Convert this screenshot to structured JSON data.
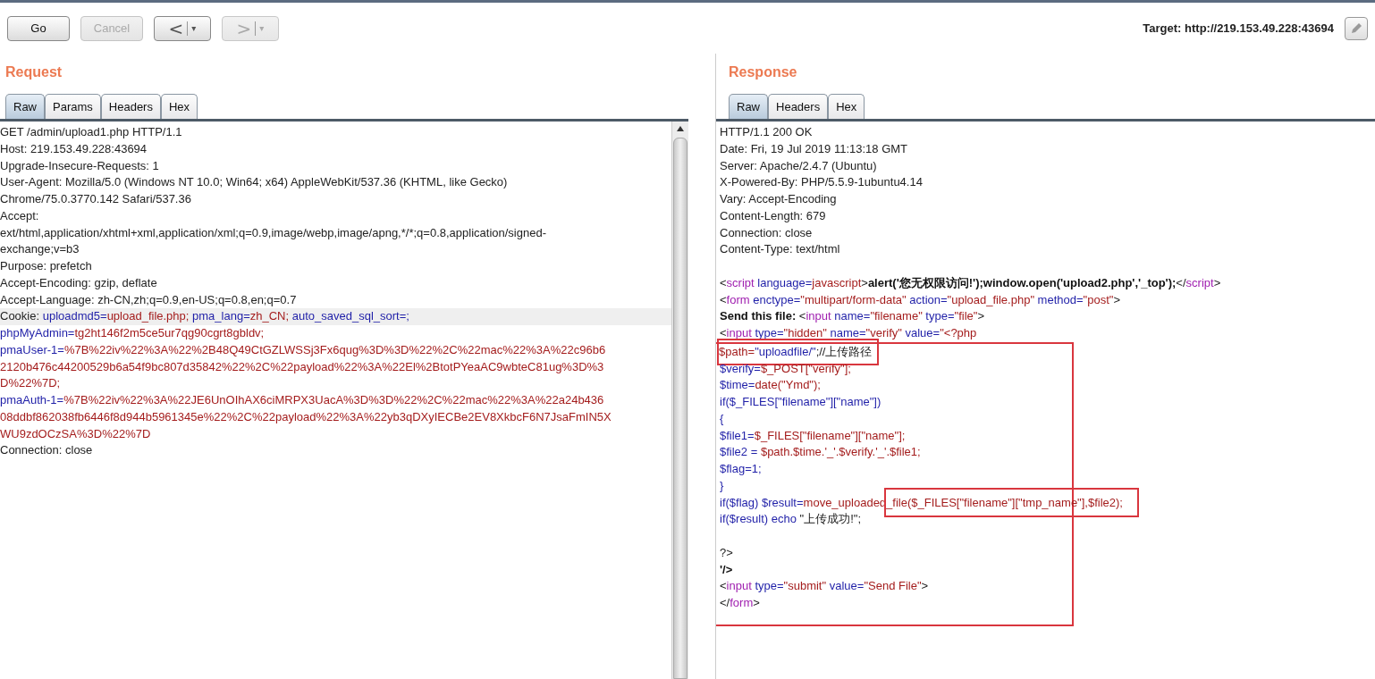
{
  "toolbar": {
    "buttons": [
      {
        "label": "Go",
        "disabled": false
      },
      {
        "label": "Cancel",
        "disabled": true
      }
    ],
    "nav": [
      {
        "arrow": "<",
        "menu": "▾",
        "disabled": false
      },
      {
        "arrow": ">",
        "menu": "▾",
        "disabled": true
      }
    ],
    "target": "Target: http://219.153.49.228:43694"
  },
  "request": {
    "title": "Request",
    "tabs": [
      {
        "label": "Raw",
        "selected": true
      },
      {
        "label": "Params",
        "selected": false
      },
      {
        "label": "Headers",
        "selected": false
      },
      {
        "label": "Hex",
        "selected": false
      }
    ],
    "lines": [
      {
        "highlighted": false,
        "segments": [
          {
            "kind": "plain",
            "text": "GET /admin/upload1.php HTTP/1.1"
          }
        ]
      },
      {
        "highlighted": false,
        "segments": [
          {
            "kind": "plain",
            "text": "Host: 219.153.49.228:43694"
          }
        ]
      },
      {
        "highlighted": false,
        "segments": [
          {
            "kind": "plain",
            "text": "Upgrade-Insecure-Requests: 1"
          }
        ]
      },
      {
        "highlighted": false,
        "segments": [
          {
            "kind": "plain",
            "text": "User-Agent: Mozilla/5.0 (Windows NT 10.0; Win64; x64) AppleWebKit/537.36 (KHTML, like Gecko)"
          }
        ]
      },
      {
        "highlighted": false,
        "segments": [
          {
            "kind": "plain",
            "text": "Chrome/75.0.3770.142 Safari/537.36"
          }
        ]
      },
      {
        "highlighted": false,
        "segments": [
          {
            "kind": "plain",
            "text": "Accept:"
          }
        ]
      },
      {
        "highlighted": false,
        "segments": [
          {
            "kind": "plain",
            "text": "ext/html,application/xhtml+xml,application/xml;q=0.9,image/webp,image/apng,*/*;q=0.8,application/signed-"
          }
        ]
      },
      {
        "highlighted": false,
        "segments": [
          {
            "kind": "plain",
            "text": "exchange;v=b3"
          }
        ]
      },
      {
        "highlighted": false,
        "segments": [
          {
            "kind": "plain",
            "text": "Purpose: prefetch"
          }
        ]
      },
      {
        "highlighted": false,
        "segments": [
          {
            "kind": "plain",
            "text": "Accept-Encoding: gzip, deflate"
          }
        ]
      },
      {
        "highlighted": false,
        "segments": [
          {
            "kind": "plain",
            "text": "Accept-Language: zh-CN,zh;q=0.9,en-US;q=0.8,en;q=0.7"
          }
        ]
      },
      {
        "highlighted": true,
        "segments": [
          {
            "kind": "plain",
            "text": "Cookie: "
          },
          {
            "kind": "key",
            "text": "uploadmd5="
          },
          {
            "kind": "value",
            "text": "upload_file.php;"
          },
          {
            "kind": "key",
            "text": " pma_lang="
          },
          {
            "kind": "value",
            "text": "zh_CN;"
          },
          {
            "kind": "key",
            "text": " auto_saved_sql_sort=;"
          }
        ]
      },
      {
        "highlighted": false,
        "segments": [
          {
            "kind": "key",
            "text": "phpMyAdmin="
          },
          {
            "kind": "value",
            "text": "tg2ht146f2m5ce5ur7qg90cgrt8gbldv;"
          }
        ]
      },
      {
        "highlighted": false,
        "segments": [
          {
            "kind": "key",
            "text": "pmaUser-1="
          },
          {
            "kind": "value",
            "text": "%7B%22iv%22%3A%22%2B48Q49CtGZLWSSj3Fx6qug%3D%3D%22%2C%22mac%22%3A%22c96b6"
          }
        ]
      },
      {
        "highlighted": false,
        "segments": [
          {
            "kind": "value",
            "text": "2120b476c44200529b6a54f9bc807d35842%22%2C%22payload%22%3A%22El%2BtotPYeaAC9wbteC81ug%3D%3"
          }
        ]
      },
      {
        "highlighted": false,
        "segments": [
          {
            "kind": "value",
            "text": "D%22%7D;"
          }
        ]
      },
      {
        "highlighted": false,
        "segments": [
          {
            "kind": "key",
            "text": "pmaAuth-1="
          },
          {
            "kind": "value",
            "text": "%7B%22iv%22%3A%22JE6UnOIhAX6ciMRPX3UacA%3D%3D%22%2C%22mac%22%3A%22a24b436"
          }
        ]
      },
      {
        "highlighted": false,
        "segments": [
          {
            "kind": "value",
            "text": "08ddbf862038fb6446f8d944b5961345e%22%2C%22payload%22%3A%22yb3qDXyIECBe2EV8XkbcF6N7JsaFmIN5X"
          }
        ]
      },
      {
        "highlighted": false,
        "segments": [
          {
            "kind": "value",
            "text": "WU9zdOCzSA%3D%22%7D"
          }
        ]
      },
      {
        "highlighted": false,
        "segments": [
          {
            "kind": "plain",
            "text": "Connection: close"
          }
        ]
      }
    ]
  },
  "response": {
    "title": "Response",
    "tabs": [
      {
        "label": "Raw",
        "selected": true
      },
      {
        "label": "Headers",
        "selected": false
      },
      {
        "label": "Hex",
        "selected": false
      }
    ],
    "blocks": [
      {
        "kind": "plain",
        "lines": [
          {
            "kind": "code",
            "segments": [
              {
                "kind": "plain",
                "text": "HTTP/1.1 200 OK"
              }
            ]
          },
          {
            "kind": "code",
            "segments": [
              {
                "kind": "plain",
                "text": "Date: Fri, 19 Jul 2019 11:13:18 GMT"
              }
            ]
          },
          {
            "kind": "code",
            "segments": [
              {
                "kind": "plain",
                "text": "Server: Apache/2.4.7 (Ubuntu)"
              }
            ]
          },
          {
            "kind": "code",
            "segments": [
              {
                "kind": "plain",
                "text": "X-Powered-By: PHP/5.5.9-1ubuntu4.14"
              }
            ]
          },
          {
            "kind": "code",
            "segments": [
              {
                "kind": "plain",
                "text": "Vary: Accept-Encoding"
              }
            ]
          },
          {
            "kind": "code",
            "segments": [
              {
                "kind": "plain",
                "text": "Content-Length: 679"
              }
            ]
          },
          {
            "kind": "code",
            "segments": [
              {
                "kind": "plain",
                "text": "Connection: close"
              }
            ]
          },
          {
            "kind": "code",
            "segments": [
              {
                "kind": "plain",
                "text": "Content-Type: text/html"
              }
            ]
          },
          {
            "kind": "blank"
          },
          {
            "kind": "code",
            "segments": [
              {
                "kind": "plain",
                "text": "<"
              },
              {
                "kind": "tag",
                "text": "script"
              },
              {
                "kind": "key",
                "text": " language="
              },
              {
                "kind": "value",
                "text": "javascript"
              },
              {
                "kind": "plain",
                "text": ">"
              },
              {
                "kind": "bold",
                "text": "alert('您无权限访问!');window.open('upload2.php','_top');"
              },
              {
                "kind": "plain",
                "text": "</"
              },
              {
                "kind": "tag",
                "text": "script"
              },
              {
                "kind": "plain",
                "text": ">"
              }
            ]
          },
          {
            "kind": "code",
            "segments": [
              {
                "kind": "plain",
                "text": "<"
              },
              {
                "kind": "tag",
                "text": "form"
              },
              {
                "kind": "key",
                "text": " enctype="
              },
              {
                "kind": "value",
                "text": "\"multipart/form-data\""
              },
              {
                "kind": "key",
                "text": " action="
              },
              {
                "kind": "value",
                "text": "\"upload_file.php\""
              },
              {
                "kind": "key",
                "text": " method="
              },
              {
                "kind": "value",
                "text": "\"post\""
              },
              {
                "kind": "plain",
                "text": ">"
              }
            ]
          },
          {
            "kind": "code",
            "segments": [
              {
                "kind": "bold",
                "text": "Send this file: "
              },
              {
                "kind": "plain",
                "text": "<"
              },
              {
                "kind": "tag",
                "text": "input"
              },
              {
                "kind": "key",
                "text": " name="
              },
              {
                "kind": "value",
                "text": "\"filename\""
              },
              {
                "kind": "key",
                "text": " type="
              },
              {
                "kind": "value",
                "text": "\"file\""
              },
              {
                "kind": "plain",
                "text": ">"
              }
            ]
          },
          {
            "kind": "code",
            "segments": [
              {
                "kind": "plain",
                "text": "<"
              },
              {
                "kind": "tag",
                "text": "input"
              },
              {
                "kind": "key",
                "text": " type="
              },
              {
                "kind": "value",
                "text": "\"hidden\""
              },
              {
                "kind": "key",
                "text": " name="
              },
              {
                "kind": "value",
                "text": "\"verify\""
              },
              {
                "kind": "key",
                "text": " value="
              },
              {
                "kind": "value",
                "text": "\"<?php"
              }
            ]
          }
        ]
      },
      {
        "kind": "framed",
        "lines": [
          {
            "kind": "code",
            "boxed_part": [
              {
                "kind": "value",
                "text": "$path="
              },
              {
                "kind": "key",
                "text": "\"uploadfile/\""
              },
              {
                "kind": "plain",
                "text": ";//上传路径"
              }
            ]
          },
          {
            "kind": "code",
            "segments": [
              {
                "kind": "key",
                "text": "$verify="
              },
              {
                "kind": "value",
                "text": "$_POST[\"verify\"];"
              }
            ]
          },
          {
            "kind": "code",
            "segments": [
              {
                "kind": "key",
                "text": "$time="
              },
              {
                "kind": "value",
                "text": "date(\"Ymd\");"
              }
            ]
          },
          {
            "kind": "code",
            "segments": [
              {
                "kind": "key",
                "text": "if($_FILES[\"filename\"][\"name\"])"
              }
            ]
          },
          {
            "kind": "code",
            "segments": [
              {
                "kind": "key",
                "text": "{"
              }
            ]
          },
          {
            "kind": "code",
            "segments": [
              {
                "kind": "key",
                "text": "$file1="
              },
              {
                "kind": "value",
                "text": "$_FILES[\"filename\"][\"name\"];"
              }
            ]
          },
          {
            "kind": "code",
            "segments": [
              {
                "kind": "key",
                "text": "$file2 = "
              },
              {
                "kind": "value",
                "text": "$path.$time.'_'.$verify.'_'.$file1;"
              }
            ]
          },
          {
            "kind": "code",
            "segments": [
              {
                "kind": "key",
                "text": "$flag=1;"
              }
            ]
          },
          {
            "kind": "code",
            "segments": [
              {
                "kind": "key",
                "text": "}"
              }
            ]
          },
          {
            "kind": "code",
            "segments": [
              {
                "kind": "key",
                "text": "if($flag) $result="
              },
              {
                "kind": "value",
                "text": "move_uploaded"
              }
            ],
            "boxed_part": [
              {
                "kind": "value",
                "text": "_file($_FILES[\"filename\"][\"tmp_name\"],$file2);"
              }
            ]
          },
          {
            "kind": "code",
            "segments": [
              {
                "kind": "key",
                "text": "if($result) echo "
              },
              {
                "kind": "plain",
                "text": "\"上传成功!\";"
              }
            ]
          },
          {
            "kind": "blank"
          },
          {
            "kind": "code",
            "segments": [
              {
                "kind": "plain",
                "text": "?>"
              }
            ]
          },
          {
            "kind": "code",
            "segments": [
              {
                "kind": "bold",
                "text": "'/>"
              }
            ]
          },
          {
            "kind": "code",
            "segments": [
              {
                "kind": "plain",
                "text": "<"
              },
              {
                "kind": "tag",
                "text": "input"
              },
              {
                "kind": "key",
                "text": " type="
              },
              {
                "kind": "value",
                "text": "\"submit\""
              },
              {
                "kind": "key",
                "text": " value="
              },
              {
                "kind": "value",
                "text": "\"Send File\""
              },
              {
                "kind": "plain",
                "text": ">"
              }
            ]
          },
          {
            "kind": "code",
            "segments": [
              {
                "kind": "plain",
                "text": "</"
              },
              {
                "kind": "tag",
                "text": "form"
              },
              {
                "kind": "plain",
                "text": ">"
              }
            ]
          }
        ]
      }
    ]
  }
}
